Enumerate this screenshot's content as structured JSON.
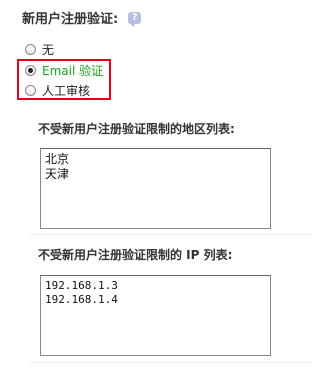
{
  "section": {
    "title": "新用户注册验证:",
    "help_icon": "question-bubble-icon"
  },
  "options": [
    {
      "label": "无",
      "checked": false
    },
    {
      "label": "Email 验证",
      "checked": true
    },
    {
      "label": "人工审核",
      "checked": false
    }
  ],
  "region_list": {
    "title": "不受新用户注册验证限制的地区列表:",
    "value": "北京\n天津"
  },
  "ip_list": {
    "title": "不受新用户注册验证限制的 IP 列表:",
    "value": "192.168.1.3\n192.168.1.4"
  },
  "colors": {
    "highlight_border": "#e0001b",
    "selected_label": "#1aa21a"
  }
}
